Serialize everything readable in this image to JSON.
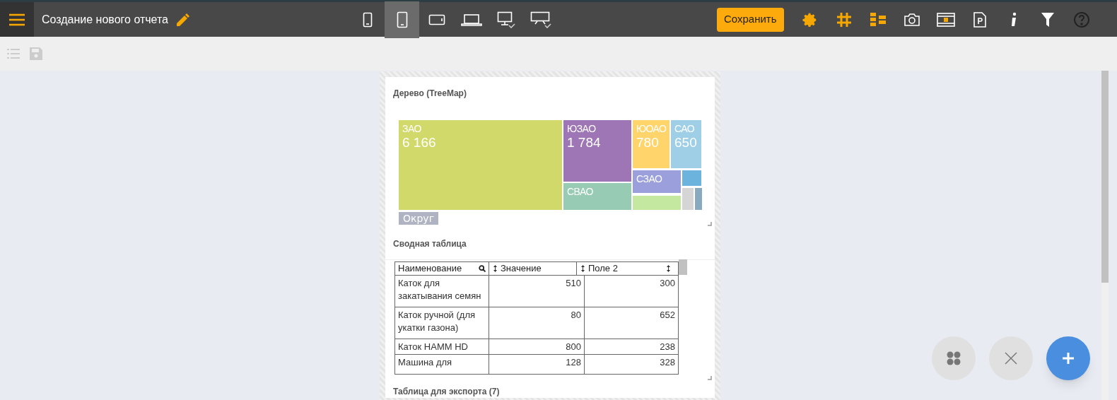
{
  "header": {
    "title": "Создание нового отчета",
    "save_label": "Сохранить",
    "devices": [
      {
        "kind": "phone",
        "selected": false
      },
      {
        "kind": "tablet",
        "selected": true
      },
      {
        "kind": "tablet-landscape",
        "selected": false
      },
      {
        "kind": "laptop",
        "selected": false
      },
      {
        "kind": "desktop",
        "selected": false
      },
      {
        "kind": "wide",
        "selected": false
      }
    ]
  },
  "treemap": {
    "title": "Дерево (TreeMap)",
    "legend": "Округ",
    "tiles": [
      {
        "label": "ЗАО",
        "value": "6 166",
        "color": "#d2d96b"
      },
      {
        "label": "ЮЗАО",
        "value": "1 784",
        "color": "#9e75b5"
      },
      {
        "label": "СВАО",
        "color": "#97cbb4"
      },
      {
        "label": "ЮОАО",
        "value": "780",
        "color": "#ffd56b"
      },
      {
        "label": "САО",
        "value": "650",
        "color": "#9fcfe6"
      },
      {
        "label": "СЗАО",
        "color": "#9b9fdc"
      },
      {
        "color": "#c5e8a0"
      },
      {
        "color": "#6cb3de"
      },
      {
        "color": "#d5d5d5"
      },
      {
        "color": "#89a9be"
      }
    ]
  },
  "pivot": {
    "title": "Сводная таблица",
    "columns": [
      "Наименование",
      "Значение",
      "Поле 2"
    ],
    "rows": [
      [
        "Каток для закатывания семян",
        "510",
        "300"
      ],
      [
        "Каток ручной (для укатки газона)",
        "80",
        "652"
      ],
      [
        "Каток HAMM HD",
        "800",
        "238"
      ],
      [
        "Машина для",
        "128",
        "328"
      ]
    ]
  },
  "export_title": "Таблица для экспорта (7)"
}
